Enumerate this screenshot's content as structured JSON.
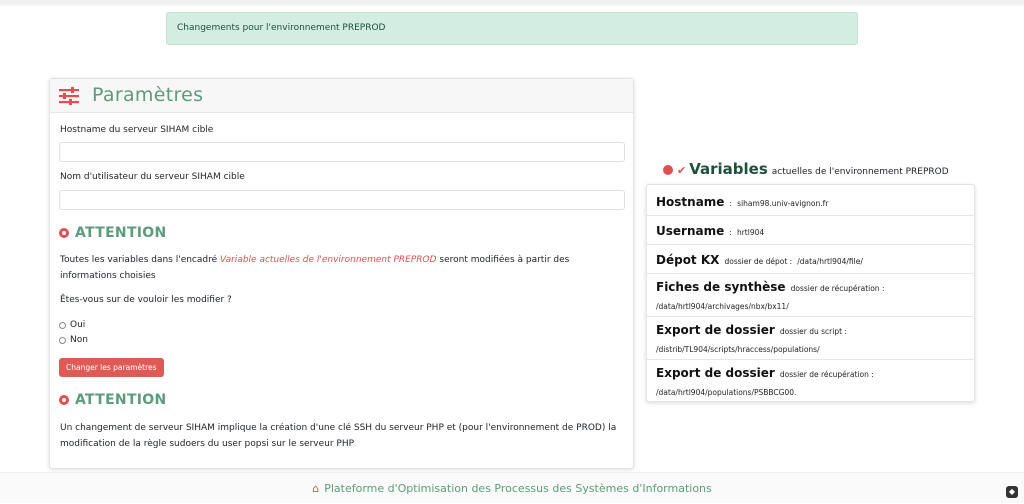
{
  "alert": {
    "text": "Changements pour l'environnement PREPROD"
  },
  "params": {
    "title": "Paramètres",
    "hostname_label": "Hostname du serveur SIHAM cible",
    "hostname_value": "",
    "username_label": "Nom d'utilisateur du serveur SIHAM cible",
    "username_value": "",
    "attention1": "ATTENTION",
    "text_before": "Toutes les variables dans l'encadré ",
    "text_link": "Variable actuelles de l'environnement PREPROD",
    "text_after": " seront modifiées à partir des informations choisies",
    "question": "Êtes-vous sur de vouloir les modifier ?",
    "option_yes": "Oui",
    "option_no": "Non",
    "button": "Changer les paramètres",
    "attention2": "ATTENTION",
    "warning": "Un changement de serveur SIHAM implique la création d'une clé SSH du serveur PHP et (pour l'environnement de PROD) la modification de la règle sudoers du user popsi sur le serveur PHP"
  },
  "variables": {
    "title_big": "Variables",
    "title_small": "actuelles de l'environnement PREPROD",
    "items": [
      {
        "key": "Hostname",
        "desc": ":",
        "value": "siham98.univ-avignon.fr"
      },
      {
        "key": "Username",
        "desc": ":",
        "value": "hrtl904"
      },
      {
        "key": "Dépot KX",
        "desc": "dossier de dépot :",
        "value": "/data/hrtl904/file/"
      },
      {
        "key": "Fiches de synthèse",
        "desc": "dossier de récupération :",
        "value": "/data/hrtl904/archivages/nbx/bx11/"
      },
      {
        "key": "Export de dossier",
        "desc": "dossier du script :",
        "value": "/distrib/TL904/scripts/hraccess/populations/"
      },
      {
        "key": "Export de dossier",
        "desc": "dossier de récupération :",
        "value": "/data/hrtl904/populations/PSBBCG00."
      }
    ]
  },
  "footer": {
    "text": "Plateforme d'Optimisation des Processus des Systèmes d'Informations"
  },
  "colors": {
    "accent": "#5c9b7b",
    "danger": "#e05050",
    "alert_bg": "#d4ede2"
  }
}
